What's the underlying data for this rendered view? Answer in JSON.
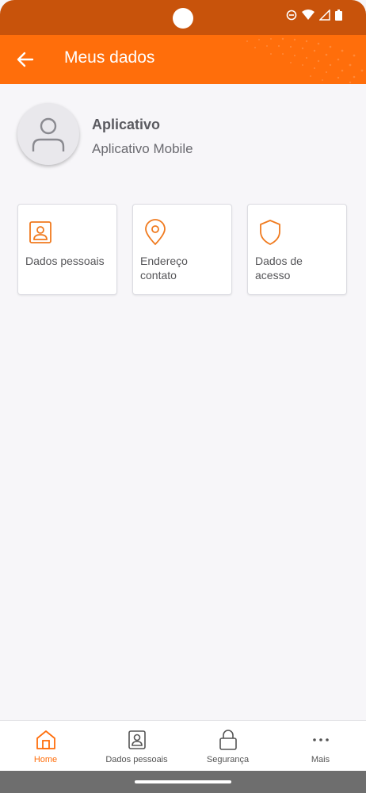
{
  "header": {
    "title": "Meus dados",
    "back_icon": "arrow-left-icon"
  },
  "profile": {
    "name": "Aplicativo",
    "subtitle": "Aplicativo Mobile"
  },
  "cards": [
    {
      "label": "Dados pessoais",
      "icon": "id-card-icon"
    },
    {
      "label": "Endereço contato",
      "icon": "map-pin-icon"
    },
    {
      "label": "Dados de acesso",
      "icon": "shield-icon"
    }
  ],
  "bottom_nav": [
    {
      "label": "Home",
      "icon": "home-icon",
      "active": true
    },
    {
      "label": "Dados pessoais",
      "icon": "id-card-icon",
      "active": false
    },
    {
      "label": "Segurança",
      "icon": "lock-icon",
      "active": false
    },
    {
      "label": "Mais",
      "icon": "more-icon",
      "active": false
    }
  ],
  "colors": {
    "primary": "#ff6e0b",
    "status_bar": "#c8530b",
    "background": "#f7f6f9"
  }
}
